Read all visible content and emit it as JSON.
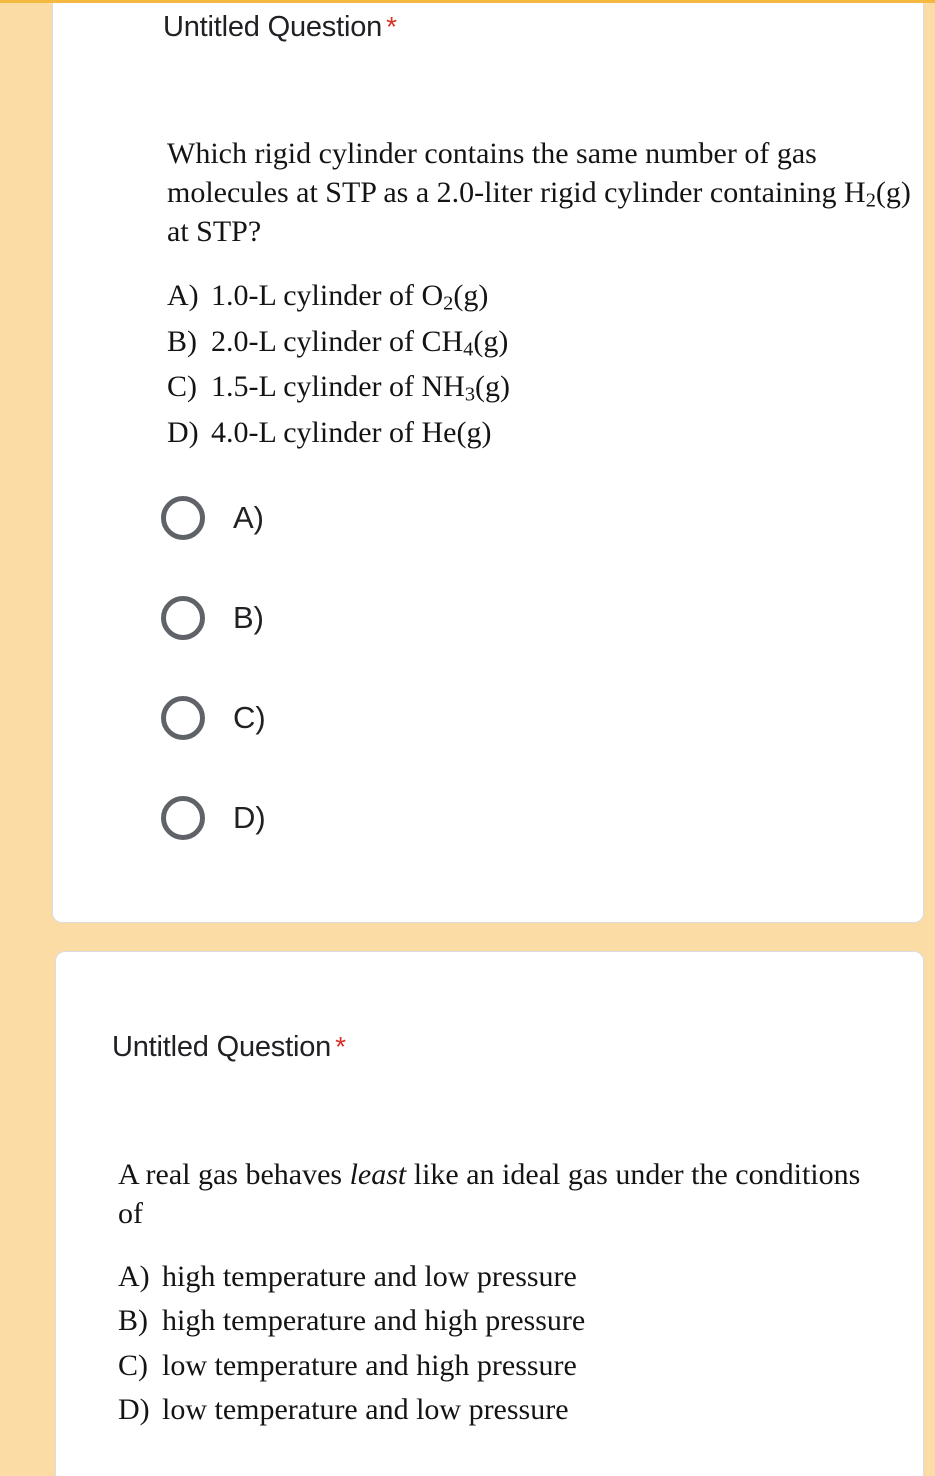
{
  "theme": {
    "background_color": "#fcdca5",
    "card_color": "#ffffff",
    "card_border_color": "#dadce0",
    "top_rule_color": "#f5b941",
    "required_star_color": "#d93025",
    "radio_stroke_color": "#5f6368",
    "text_color": "#202124"
  },
  "questions": [
    {
      "title": "Untitled Question",
      "required_marker": "*",
      "image": {
        "stem_lines": [
          "Which rigid cylinder contains the same number of gas molecules at STP as a 2.0-liter rigid cylinder containing H2(g) at STP?"
        ],
        "stem_html": "Which rigid cylinder contains the same number of gas molecules at STP as a 2.0-liter rigid cylinder containing H<sub>2</sub>(g) at STP?",
        "options": [
          {
            "label": "A)",
            "text": "1.0-L cylinder of O2(g)",
            "html": "1.0-L cylinder of O<sub>2</sub>(g)"
          },
          {
            "label": "B)",
            "text": "2.0-L cylinder of CH4(g)",
            "html": "2.0-L cylinder of CH<sub>4</sub>(g)"
          },
          {
            "label": "C)",
            "text": "1.5-L cylinder of NH3(g)",
            "html": "1.5-L cylinder of NH<sub>3</sub>(g)"
          },
          {
            "label": "D)",
            "text": "4.0-L cylinder of He(g)",
            "html": "4.0-L cylinder of He(g)"
          }
        ]
      },
      "choices": [
        {
          "label": "A)",
          "selected": false
        },
        {
          "label": "B)",
          "selected": false
        },
        {
          "label": "C)",
          "selected": false
        },
        {
          "label": "D)",
          "selected": false
        }
      ]
    },
    {
      "title": "Untitled Question",
      "required_marker": "*",
      "image": {
        "stem_lines": [
          "A real gas behaves least like an ideal gas under the conditions of"
        ],
        "stem_html": "A real gas behaves <em>least</em> like an ideal gas under the conditions of",
        "options": [
          {
            "label": "A)",
            "text": "high temperature and low pressure",
            "html": "high temperature and low pressure"
          },
          {
            "label": "B)",
            "text": "high temperature and high pressure",
            "html": "high temperature and high pressure"
          },
          {
            "label": "C)",
            "text": "low temperature and high pressure",
            "html": "low temperature and high pressure"
          },
          {
            "label": "D)",
            "text": "low temperature and low pressure",
            "html": "low temperature and low pressure"
          }
        ]
      },
      "choices": []
    }
  ]
}
